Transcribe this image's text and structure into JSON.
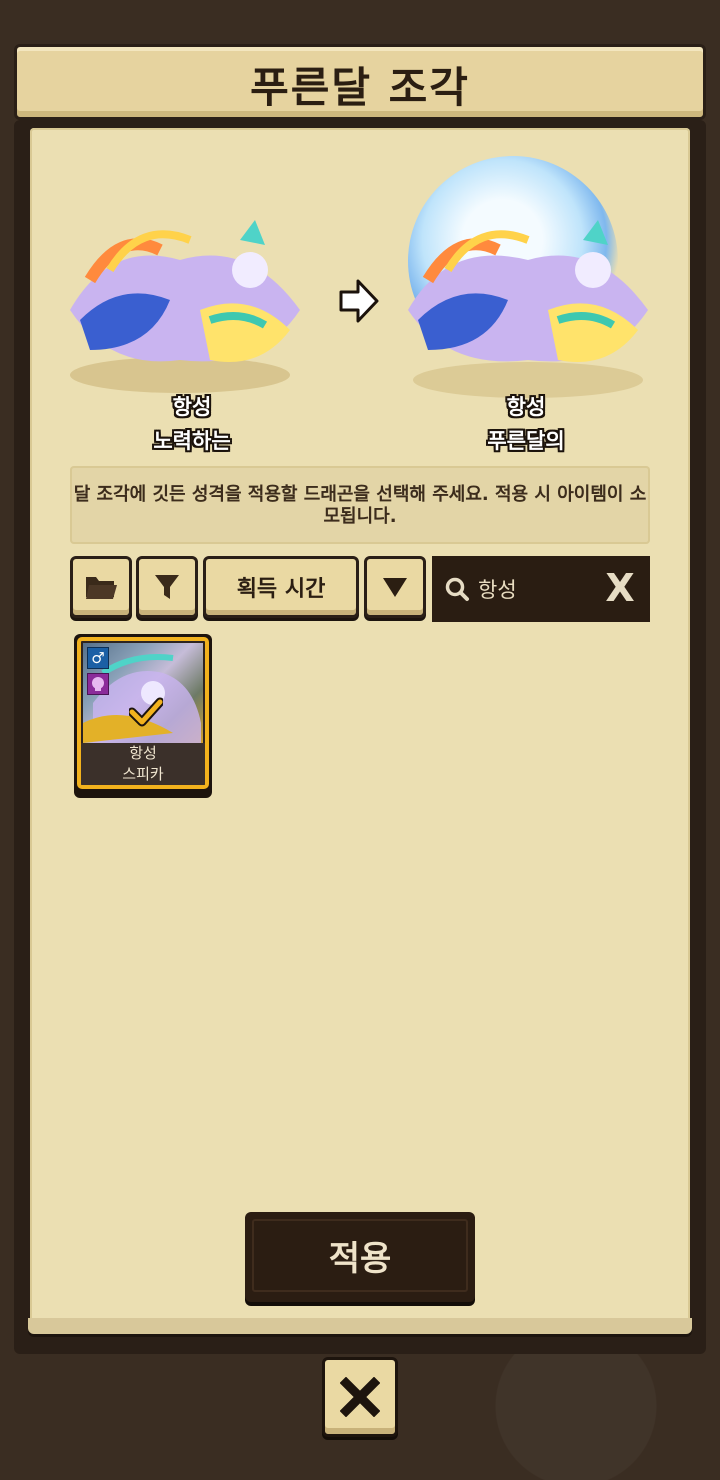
{
  "title": "푸른달 조각",
  "before": {
    "line1": "항성",
    "line2": "노력하는"
  },
  "after": {
    "line1": "항성",
    "line2": "푸른달의"
  },
  "info_text": "달 조각에 깃든 성격을 적용할 드래곤을 선택해 주세요. 적용 시 아이템이 소모됩니다.",
  "toolbar": {
    "folder_icon": "folder-icon",
    "filter_icon": "filter-icon",
    "sort_label": "획득 시간",
    "order_icon": "triangle-down-icon"
  },
  "search": {
    "value": "항성",
    "clear_label": "X"
  },
  "cards": [
    {
      "line1": "항성",
      "line2": "스피카",
      "gender": "♂",
      "selected": true
    }
  ],
  "apply_label": "적용",
  "colors": {
    "accent": "#f2b21d",
    "panel": "#ebdfb2",
    "dark": "#2a1f17"
  }
}
